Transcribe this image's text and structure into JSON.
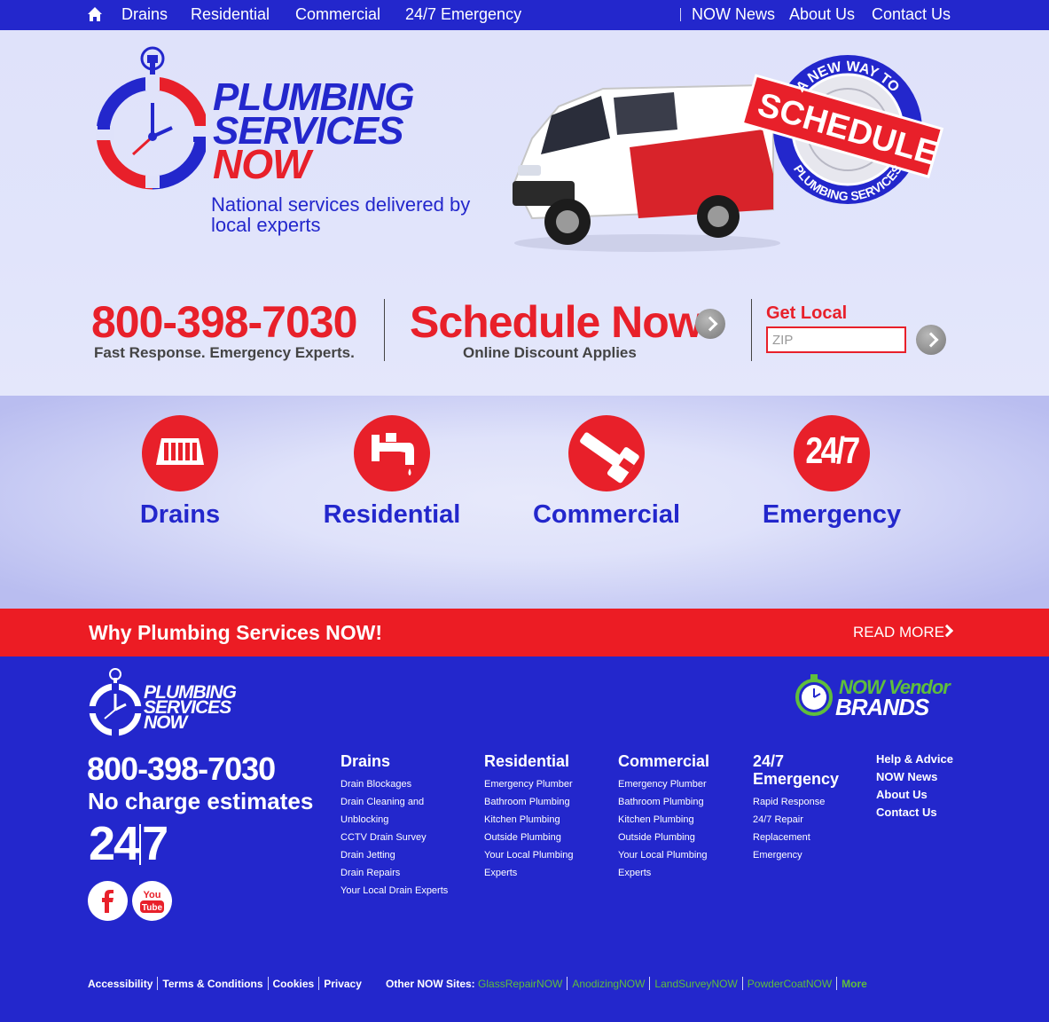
{
  "topnav": {
    "home_icon": "home-icon",
    "left_items": [
      "Drains",
      "Residential",
      "Commercial",
      "24/7 Emergency"
    ],
    "right_items": [
      "NOW News",
      "About Us",
      "Contact Us"
    ]
  },
  "hero": {
    "brand_line1": "PLUMBING",
    "brand_line2": "SERVICES",
    "brand_line3": "NOW",
    "tagline": "National services delivered by local experts",
    "stamp_top": "A NEW WAY TO",
    "stamp_main": "SCHEDULE",
    "stamp_bottom": "PLUMBING SERVICES",
    "colors": {
      "blue": "#2327cc",
      "red": "#e8202a"
    }
  },
  "cta": {
    "phone": "800-398-7030",
    "phone_sub": "Fast Response. Emergency Experts.",
    "schedule": "Schedule Now",
    "schedule_sub": "Online Discount Applies",
    "get_local": "Get Local",
    "zip_placeholder": "ZIP"
  },
  "services": [
    {
      "label": "Drains",
      "icon": "drain-grate-icon"
    },
    {
      "label": "Residential",
      "icon": "faucet-icon"
    },
    {
      "label": "Commercial",
      "icon": "pipe-wrench-icon"
    },
    {
      "label": "Emergency",
      "icon": "24-7-icon",
      "icon_text": "24/7"
    }
  ],
  "banner": {
    "title": "Why Plumbing Services NOW!",
    "read_more": "READ MORE"
  },
  "footer": {
    "logo_line1": "PLUMBING",
    "logo_line2": "SERVICES",
    "logo_line3": "NOW",
    "vendor_line1": "NOW Vendor",
    "vendor_line2": "BRANDS",
    "phone": "800-398-7030",
    "estimates": "No charge estimates",
    "hours_a": "24",
    "hours_b": "7",
    "columns": [
      {
        "title": "Drains",
        "links": [
          "Drain Blockages",
          "Drain Cleaning and",
          "Unblocking",
          "CCTV Drain Survey",
          "Drain Jetting",
          "Drain Repairs",
          "Your Local Drain Experts"
        ]
      },
      {
        "title": "Residential",
        "links": [
          "Emergency Plumber",
          "Bathroom Plumbing",
          "Kitchen Plumbing",
          "Outside Plumbing",
          "Your Local Plumbing",
          "Experts"
        ]
      },
      {
        "title": "Commercial",
        "links": [
          "Emergency Plumber",
          "Bathroom Plumbing",
          "Kitchen Plumbing",
          "Outside Plumbing",
          "Your Local Plumbing",
          "Experts"
        ]
      },
      {
        "title_line1": "24/7",
        "title_line2": "Emergency",
        "links": [
          "Rapid Response",
          "24/7 Repair",
          "Replacement",
          "Emergency"
        ]
      }
    ],
    "help_links": [
      "Help & Advice",
      "NOW News",
      "About Us",
      "Contact Us"
    ],
    "legal": [
      "Accessibility",
      "Terms & Conditions",
      "Cookies",
      "Privacy"
    ],
    "other_sites_label": "Other NOW Sites:",
    "other_sites": [
      "GlassRepairNOW",
      "AnodizingNOW",
      "LandSurveyNOW",
      "PowderCoatNOW"
    ],
    "more": "More",
    "accent_green": "#5fbe3c"
  }
}
